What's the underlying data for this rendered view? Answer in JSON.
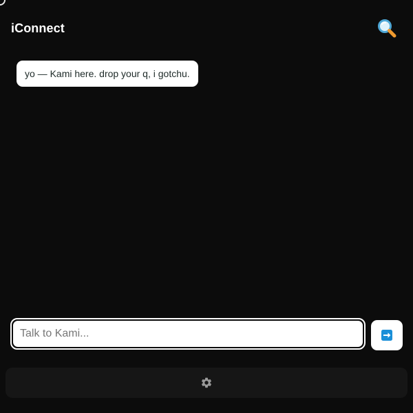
{
  "header": {
    "title": "iConnect",
    "search_icon": "magnifying-glass-icon"
  },
  "chat": {
    "messages": [
      {
        "sender": "Kami",
        "text": "yo — Kami here. drop your q, i gotchu."
      }
    ]
  },
  "composer": {
    "placeholder": "Talk to Kami...",
    "value": "",
    "send_icon": "right-arrow-icon"
  },
  "bottom_bar": {
    "settings_icon": "gear-icon"
  },
  "colors": {
    "background": "#0c0c0c",
    "bubble": "#ffffff",
    "send_icon": "#1a8fd8",
    "bottom_bar": "#161616"
  }
}
